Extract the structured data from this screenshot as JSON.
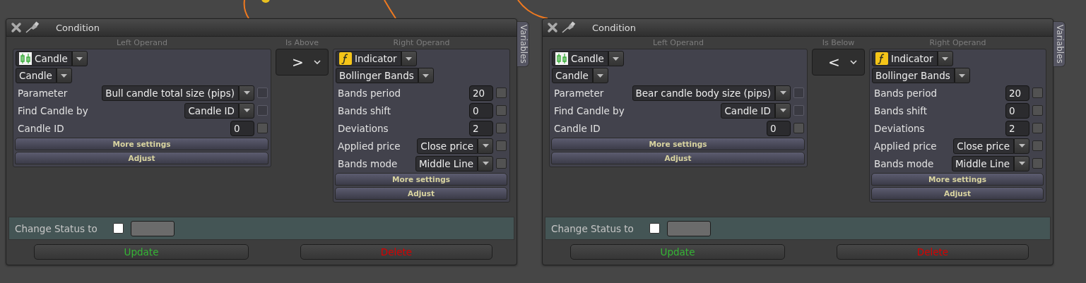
{
  "conditions": [
    {
      "title": "Condition",
      "side_tab": "Variables",
      "left": {
        "header": "Left Operand",
        "type": {
          "kind": "candle",
          "value": "Candle"
        },
        "sub": "Candle",
        "rows": [
          {
            "label": "Parameter",
            "kind": "select",
            "value": "Bull candle total size (pips)",
            "check": {
              "checked": false,
              "disabled": true
            }
          },
          {
            "label": "Find Candle by",
            "kind": "select",
            "value": "Candle ID",
            "check": {
              "checked": false,
              "disabled": true
            }
          },
          {
            "label": "Candle ID",
            "kind": "number",
            "value": "0",
            "check": {
              "checked": false,
              "disabled": false
            }
          }
        ],
        "buttons": [
          "More settings",
          "Adjust"
        ]
      },
      "operator": {
        "header": "Is Above",
        "value": ">"
      },
      "right": {
        "header": "Right Operand",
        "type": {
          "kind": "indicator",
          "value": "Indicator"
        },
        "sub": "Bollinger Bands",
        "rows": [
          {
            "label": "Bands period",
            "kind": "number",
            "value": "20",
            "check": {
              "checked": false,
              "disabled": false
            }
          },
          {
            "label": "Bands shift",
            "kind": "number",
            "value": "0",
            "check": {
              "checked": false,
              "disabled": false
            }
          },
          {
            "label": "Deviations",
            "kind": "number",
            "value": "2",
            "check": {
              "checked": false,
              "disabled": false
            }
          },
          {
            "label": "Applied price",
            "kind": "select",
            "value": "Close price",
            "check": {
              "checked": false,
              "disabled": false
            }
          },
          {
            "label": "Bands mode",
            "kind": "select",
            "value": "Middle Line",
            "check": {
              "checked": false,
              "disabled": false
            }
          }
        ],
        "buttons": [
          "More settings",
          "Adjust"
        ]
      },
      "status": {
        "label": "Change Status to",
        "checked": false
      },
      "actions": [
        {
          "label": "Update",
          "kind": "update"
        },
        {
          "label": "Delete",
          "kind": "delete"
        }
      ]
    },
    {
      "title": "Condition",
      "side_tab": "Variables",
      "left": {
        "header": "Left Operand",
        "type": {
          "kind": "candle",
          "value": "Candle"
        },
        "sub": "Candle",
        "rows": [
          {
            "label": "Parameter",
            "kind": "select",
            "value": "Bear candle body size (pips)",
            "check": {
              "checked": false,
              "disabled": true
            }
          },
          {
            "label": "Find Candle by",
            "kind": "select",
            "value": "Candle ID",
            "check": {
              "checked": false,
              "disabled": true
            }
          },
          {
            "label": "Candle ID",
            "kind": "number",
            "value": "0",
            "check": {
              "checked": false,
              "disabled": false
            }
          }
        ],
        "buttons": [
          "More settings",
          "Adjust"
        ]
      },
      "operator": {
        "header": "Is Below",
        "value": "<"
      },
      "right": {
        "header": "Right Operand",
        "type": {
          "kind": "indicator",
          "value": "Indicator"
        },
        "sub": "Bollinger Bands",
        "rows": [
          {
            "label": "Bands period",
            "kind": "number",
            "value": "20",
            "check": {
              "checked": false,
              "disabled": false
            }
          },
          {
            "label": "Bands shift",
            "kind": "number",
            "value": "0",
            "check": {
              "checked": false,
              "disabled": false
            }
          },
          {
            "label": "Deviations",
            "kind": "number",
            "value": "2",
            "check": {
              "checked": false,
              "disabled": false
            }
          },
          {
            "label": "Applied price",
            "kind": "select",
            "value": "Close price",
            "check": {
              "checked": false,
              "disabled": false
            }
          },
          {
            "label": "Bands mode",
            "kind": "select",
            "value": "Middle Line",
            "check": {
              "checked": false,
              "disabled": false
            }
          }
        ],
        "buttons": [
          "More settings",
          "Adjust"
        ]
      },
      "status": {
        "label": "Change Status to",
        "checked": false
      },
      "actions": [
        {
          "label": "Update",
          "kind": "update"
        },
        {
          "label": "Delete",
          "kind": "delete"
        }
      ]
    }
  ]
}
